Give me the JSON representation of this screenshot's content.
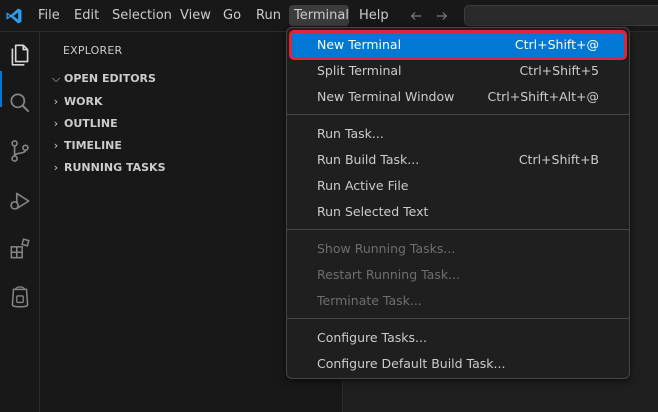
{
  "menubar": {
    "items": [
      "File",
      "Edit",
      "Selection",
      "View",
      "Go",
      "Run",
      "Terminal",
      "Help"
    ],
    "active": "Terminal"
  },
  "explorer": {
    "title": "EXPLORER",
    "sections": [
      "OPEN EDITORS",
      "WORK",
      "OUTLINE",
      "TIMELINE",
      "RUNNING TASKS"
    ],
    "open_editors_expanded": true
  },
  "terminal_menu": {
    "groups": [
      [
        {
          "label": "New Terminal",
          "shortcut": "Ctrl+Shift+@",
          "highlighted": true,
          "disabled": false
        },
        {
          "label": "Split Terminal",
          "shortcut": "Ctrl+Shift+5",
          "highlighted": false,
          "disabled": false
        },
        {
          "label": "New Terminal Window",
          "shortcut": "Ctrl+Shift+Alt+@",
          "highlighted": false,
          "disabled": false
        }
      ],
      [
        {
          "label": "Run Task...",
          "shortcut": "",
          "highlighted": false,
          "disabled": false
        },
        {
          "label": "Run Build Task...",
          "shortcut": "Ctrl+Shift+B",
          "highlighted": false,
          "disabled": false
        },
        {
          "label": "Run Active File",
          "shortcut": "",
          "highlighted": false,
          "disabled": false
        },
        {
          "label": "Run Selected Text",
          "shortcut": "",
          "highlighted": false,
          "disabled": false
        }
      ],
      [
        {
          "label": "Show Running Tasks...",
          "shortcut": "",
          "highlighted": false,
          "disabled": true
        },
        {
          "label": "Restart Running Task...",
          "shortcut": "",
          "highlighted": false,
          "disabled": true
        },
        {
          "label": "Terminate Task...",
          "shortcut": "",
          "highlighted": false,
          "disabled": true
        }
      ],
      [
        {
          "label": "Configure Tasks...",
          "shortcut": "",
          "highlighted": false,
          "disabled": false
        },
        {
          "label": "Configure Default Build Task...",
          "shortcut": "",
          "highlighted": false,
          "disabled": false
        }
      ]
    ]
  },
  "activity_icons": [
    "explorer-icon",
    "search-icon",
    "source-control-icon",
    "run-debug-icon",
    "extensions-icon",
    "remote-icon"
  ],
  "colors": {
    "accent": "#0078d4",
    "highlight_border": "#e0243a",
    "menu_bg": "#1f1f1f",
    "titlebar_bg": "#181818"
  }
}
